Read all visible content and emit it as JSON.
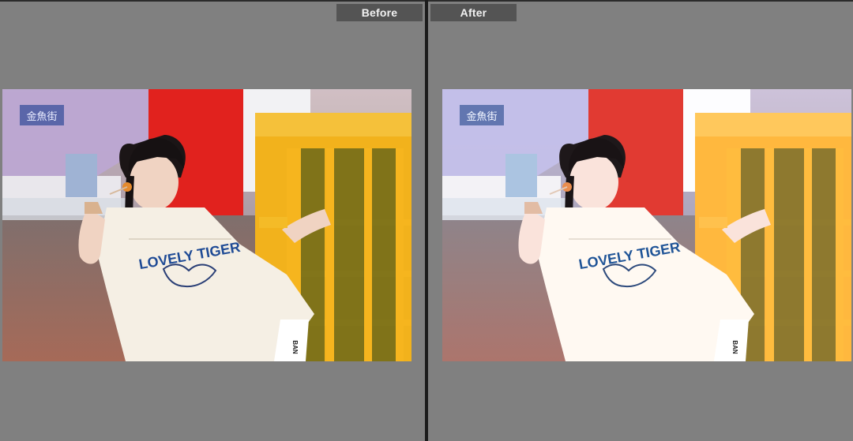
{
  "labels": {
    "before": "Before",
    "after": "After"
  },
  "photo": {
    "shirt_text": "LOVELY TIGER",
    "sign_text": "金魚街"
  },
  "colors": {
    "background": "#808080",
    "tag_background": "#545454",
    "tag_text": "#f2f2f2",
    "divider": "#1c1c1c"
  }
}
